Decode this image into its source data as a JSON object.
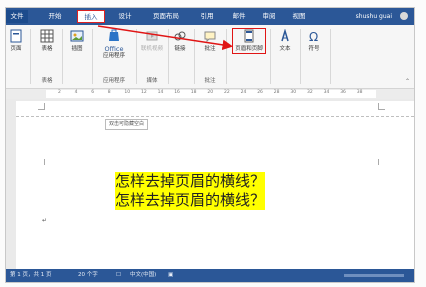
{
  "tabs": {
    "file": "文件",
    "home": "开始",
    "insert": "插入",
    "design": "设计",
    "layout": "页面布局",
    "references": "引用",
    "mailings": "邮件",
    "review": "审阅",
    "view": "视图"
  },
  "user_name": "shushu guai",
  "ribbon": {
    "cover_label": "页面",
    "table_label": "表格",
    "table_group": "表格",
    "pictures_label": "插图",
    "office_label_1": "Office",
    "office_label_2": "应用程序",
    "apps_group": "应用程序",
    "online_video_label": "联机视频",
    "media_group": "媒体",
    "links_label": "链接",
    "comment_label": "批注",
    "comments_group": "批注",
    "header_footer_label": "页眉和页脚",
    "text_label": "文本",
    "symbols_label": "符号"
  },
  "ruler_numbers": [
    "2",
    "4",
    "6",
    "8",
    "10",
    "12",
    "14",
    "16",
    "18",
    "20",
    "22",
    "24",
    "26",
    "28",
    "30",
    "32",
    "34",
    "36",
    "38"
  ],
  "tooltip": "双击可隐藏空白",
  "doc_lines": [
    "怎样去掉页眉的横线？",
    "怎样去掉页眉的横线？"
  ],
  "status": {
    "page": "第 1 页，共 1 页",
    "words": "20 个字",
    "lang": "中文(中国)"
  },
  "colors": {
    "accent": "#2b5797",
    "highlight": "#ffff00",
    "callout": "#e01515"
  }
}
